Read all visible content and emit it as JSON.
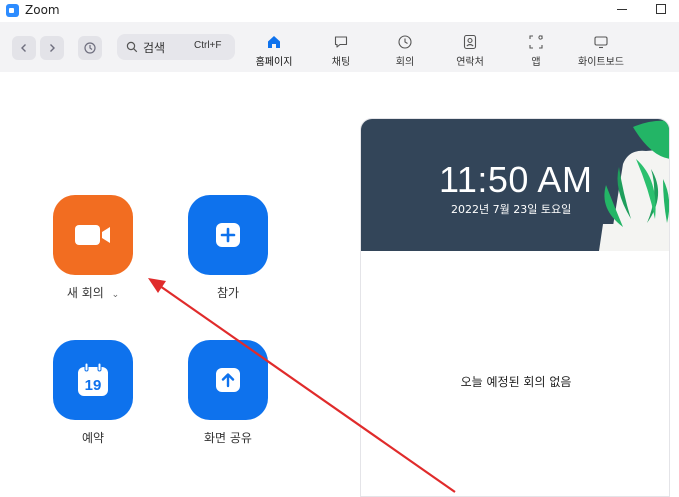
{
  "window": {
    "title": "Zoom"
  },
  "search": {
    "label": "검색",
    "shortcut": "Ctrl+F"
  },
  "tabs": [
    {
      "label": "홈페이지",
      "icon": "home-icon",
      "active": true
    },
    {
      "label": "채팅",
      "icon": "chat-icon"
    },
    {
      "label": "회의",
      "icon": "clock-icon"
    },
    {
      "label": "연락처",
      "icon": "contacts-icon"
    },
    {
      "label": "앱",
      "icon": "apps-icon"
    },
    {
      "label": "화이트보드",
      "icon": "whiteboard-icon"
    }
  ],
  "actions": {
    "new_meeting": {
      "label": "새 회의",
      "color": "#F26D21",
      "icon": "video-camera-icon"
    },
    "join": {
      "label": "참가",
      "color": "#0E72ED",
      "icon": "plus-icon"
    },
    "schedule": {
      "label": "예약",
      "color": "#0E72ED",
      "icon": "calendar-icon",
      "calendar_day": "19"
    },
    "share_screen": {
      "label": "화면 공유",
      "color": "#0E72ED",
      "icon": "upload-arrow-icon"
    }
  },
  "panel": {
    "time": "11:50 AM",
    "date": "2022년 7월 23일 토요일",
    "empty_message": "오늘 예정된 회의 없음"
  },
  "colors": {
    "accent": "#0E72ED",
    "banner": "#334559",
    "annotation_arrow": "#E02B2B"
  }
}
